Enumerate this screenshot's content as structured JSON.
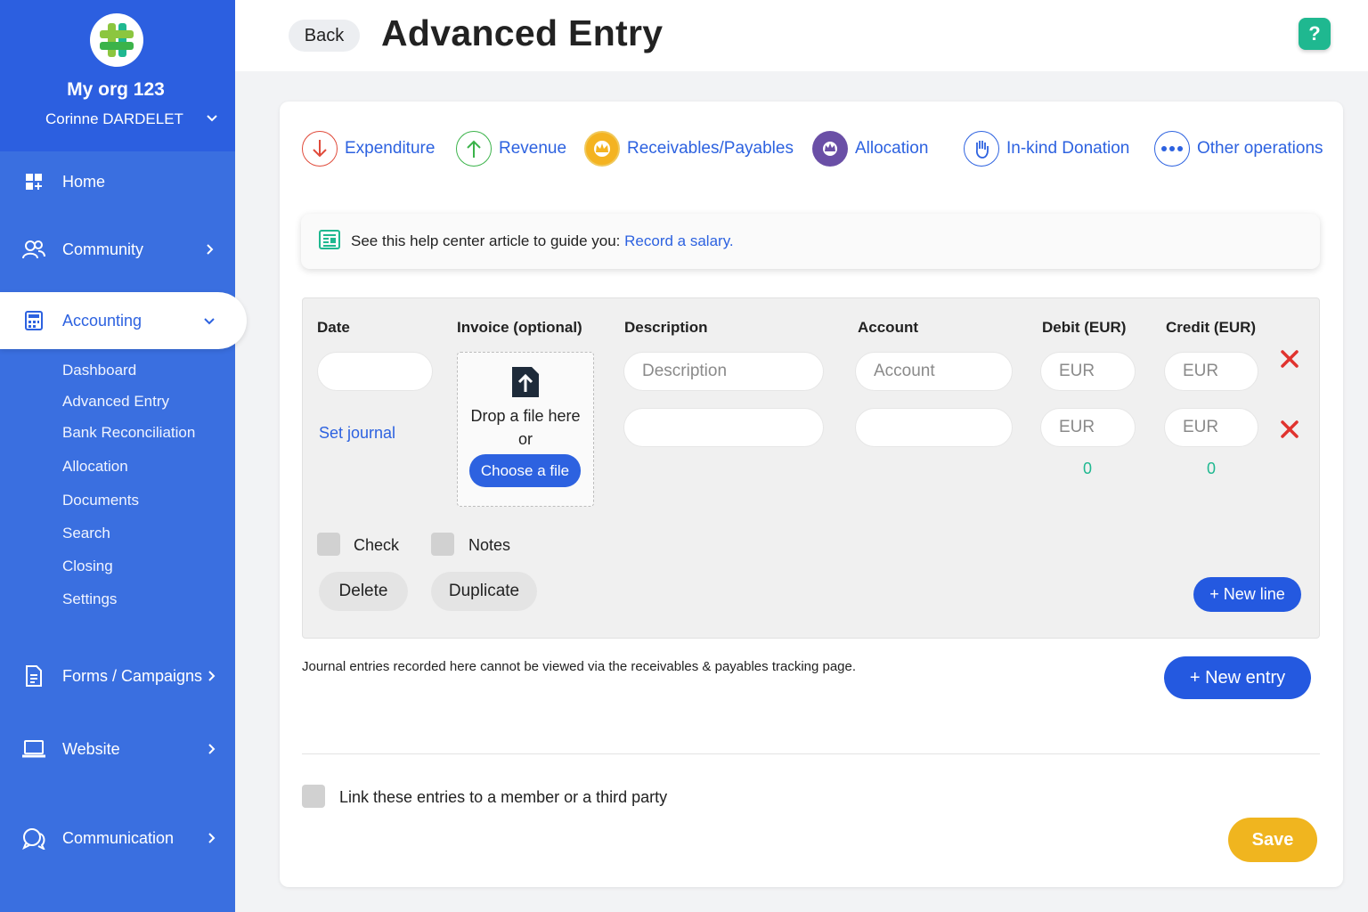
{
  "org": {
    "name": "My org 123",
    "user": "Corinne DARDELET"
  },
  "nav": {
    "home": "Home",
    "community": "Community",
    "accounting": "Accounting",
    "accounting_sub": [
      "Dashboard",
      "Advanced Entry",
      "Bank Reconciliation",
      "Allocation",
      "Documents",
      "Search",
      "Closing",
      "Settings"
    ],
    "forms": "Forms / Campaigns",
    "website": "Website",
    "communication": "Communication"
  },
  "header": {
    "back": "Back",
    "title": "Advanced Entry",
    "help": "?"
  },
  "operations": [
    "Expenditure",
    "Revenue",
    "Receivables/Payables",
    "Allocation",
    "In-kind Donation",
    "Other operations"
  ],
  "help_banner": {
    "text": "See this help center article to guide you:",
    "link": "Record a salary."
  },
  "columns": {
    "date": "Date",
    "invoice": "Invoice (optional)",
    "description": "Description",
    "account": "Account",
    "debit": "Debit (EUR)",
    "credit": "Credit (EUR)"
  },
  "row1": {
    "description_placeholder": "Description",
    "account_placeholder": "Account",
    "debit_placeholder": "EUR",
    "credit_placeholder": "EUR"
  },
  "row2": {
    "debit_placeholder": "EUR",
    "credit_placeholder": "EUR"
  },
  "totals": {
    "debit": "0",
    "credit": "0"
  },
  "set_journal": "Set journal",
  "dropzone": {
    "line1": "Drop a file here",
    "line2": "or",
    "button": "Choose a file"
  },
  "options": {
    "check": "Check",
    "notes": "Notes"
  },
  "buttons": {
    "delete": "Delete",
    "duplicate": "Duplicate",
    "new_line": "+ New line",
    "new_entry": "+ New entry",
    "save": "Save"
  },
  "note": "Journal entries recorded here cannot be viewed via the receivables & payables tracking page.",
  "link_entries": "Link these entries to a member or a third party"
}
